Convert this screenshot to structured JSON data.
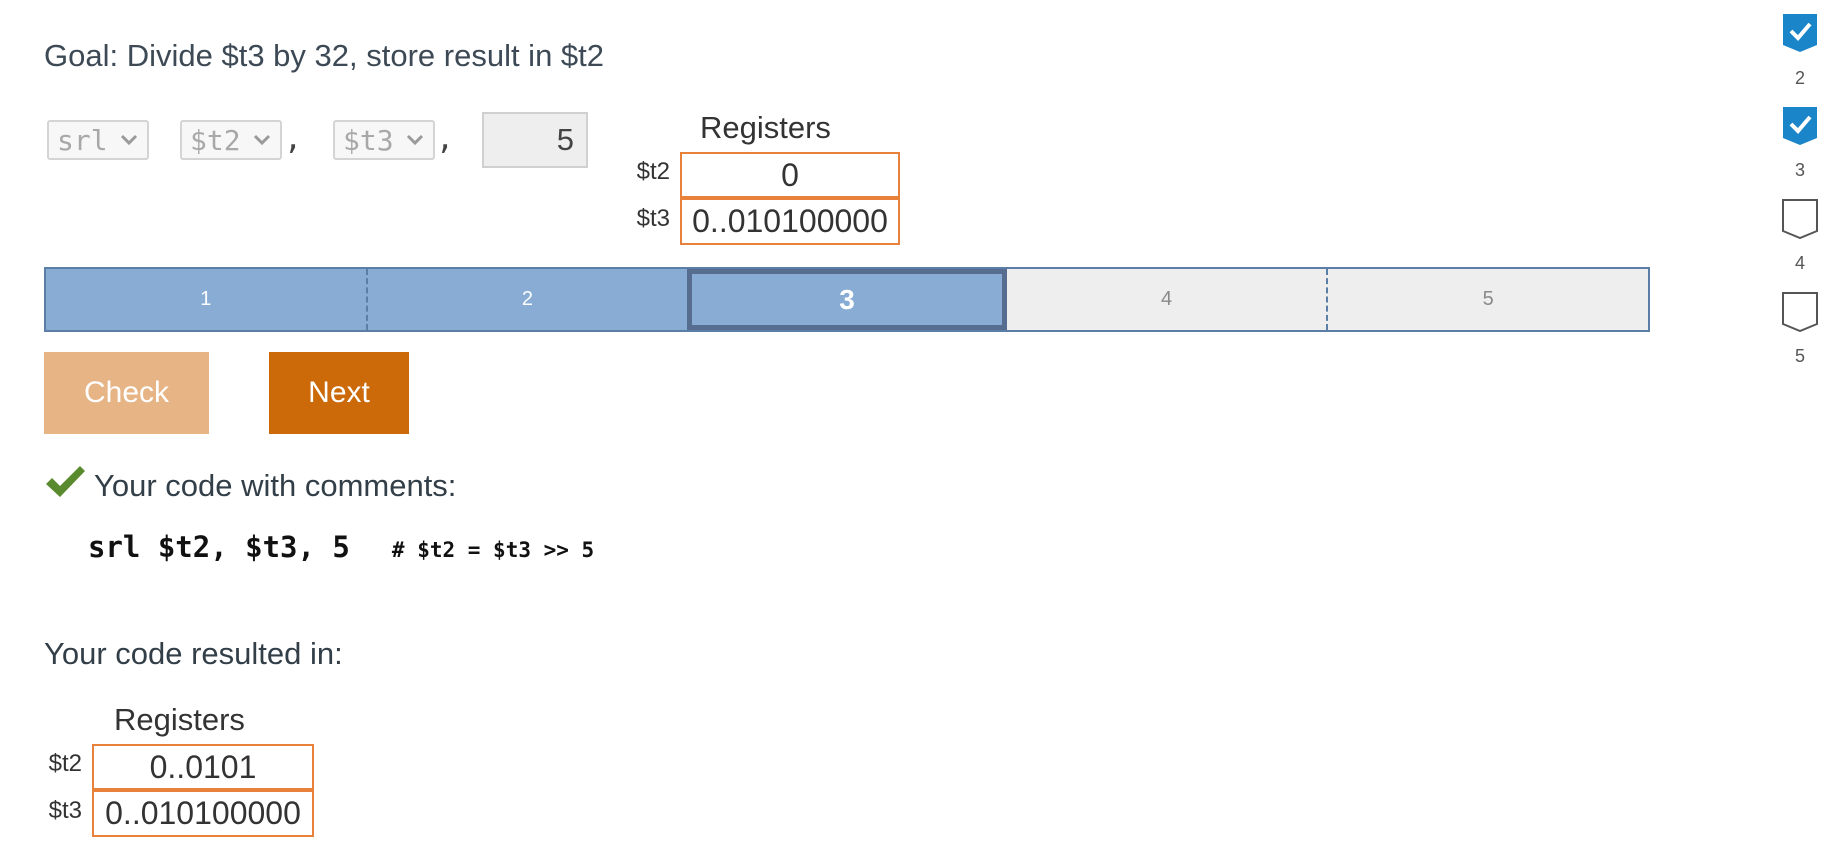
{
  "goal": "Goal: Divide $t3 by 32, store result in $t2",
  "instruction": {
    "op": "srl",
    "rd": "$t2",
    "rs": "$t3",
    "comma": ",",
    "shamt": "5"
  },
  "registers_before": {
    "title": "Registers",
    "rows": [
      {
        "label": "$t2",
        "value": "0"
      },
      {
        "label": "$t3",
        "value": "0..010100000"
      }
    ]
  },
  "progress": {
    "segments": [
      "1",
      "2",
      "3",
      "4",
      "5"
    ],
    "current": 3,
    "completed": 2
  },
  "buttons": {
    "check": "Check",
    "next": "Next"
  },
  "feedback": {
    "heading": "Your code with comments:",
    "code": "srl $t2, $t3, 5",
    "comment": "# $t2 = $t3 >> 5"
  },
  "result": {
    "label": "Your code resulted in:",
    "title": "Registers",
    "rows": [
      {
        "label": "$t2",
        "value": "0..0101"
      },
      {
        "label": "$t3",
        "value": "0..010100000"
      }
    ]
  },
  "sidebar": {
    "items": [
      {
        "num": "2",
        "checked": true
      },
      {
        "num": "3",
        "checked": true
      },
      {
        "num": "4",
        "checked": false
      },
      {
        "num": "5",
        "checked": false
      }
    ]
  },
  "colors": {
    "accent_blue": "#1a85c8",
    "progress_done": "#88acd4",
    "register_border": "#e8823a",
    "next_button": "#cc6a0a",
    "check_button": "#e6b485",
    "success_check": "#5a8a2e"
  }
}
